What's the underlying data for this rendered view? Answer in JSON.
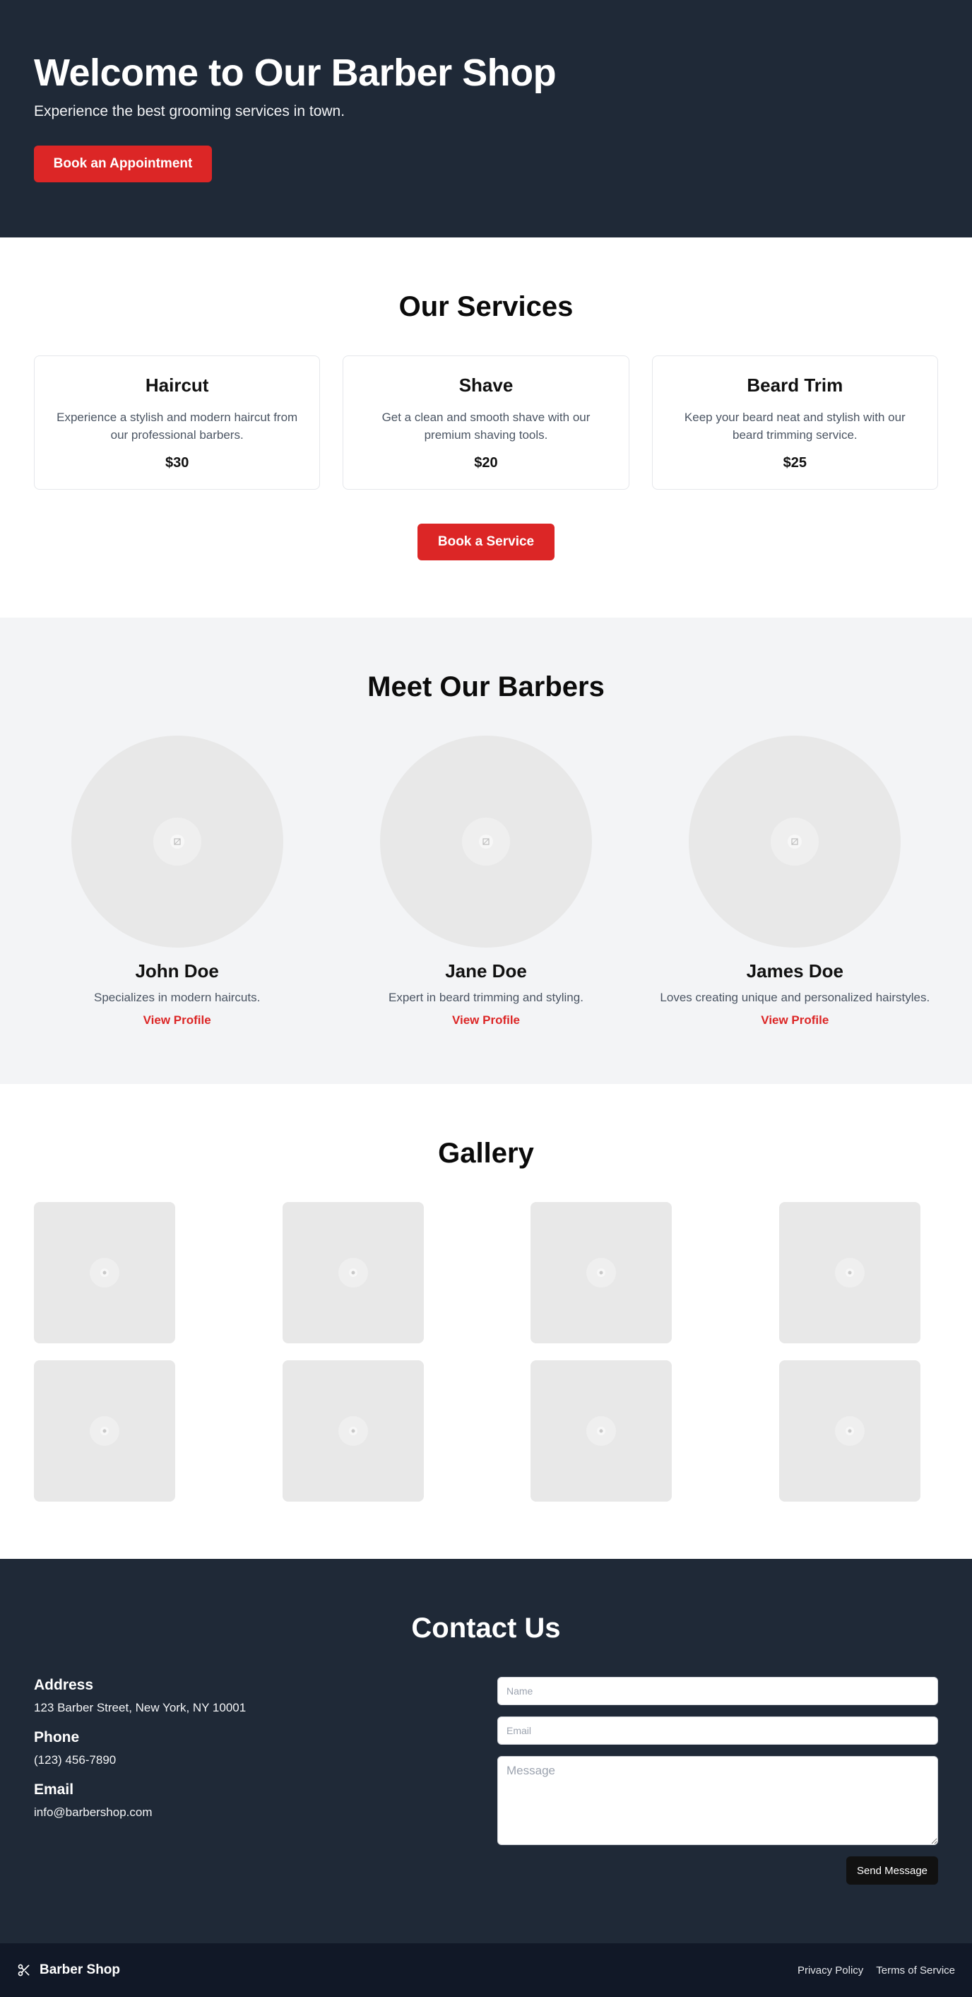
{
  "hero": {
    "title": "Welcome to Our Barber Shop",
    "subtitle": "Experience the best grooming services in town.",
    "cta_label": "Book an Appointment"
  },
  "services": {
    "title": "Our Services",
    "items": [
      {
        "name": "Haircut",
        "description": "Experience a stylish and modern haircut from our professional barbers.",
        "price": "$30"
      },
      {
        "name": "Shave",
        "description": "Get a clean and smooth shave with our premium shaving tools.",
        "price": "$20"
      },
      {
        "name": "Beard Trim",
        "description": "Keep your beard neat and stylish with our beard trimming service.",
        "price": "$25"
      }
    ],
    "cta_label": "Book a Service"
  },
  "barbers": {
    "title": "Meet Our Barbers",
    "items": [
      {
        "name": "John Doe",
        "bio": "Specializes in modern haircuts.",
        "link_label": "View Profile"
      },
      {
        "name": "Jane Doe",
        "bio": "Expert in beard trimming and styling.",
        "link_label": "View Profile"
      },
      {
        "name": "James Doe",
        "bio": "Loves creating unique and personalized hairstyles.",
        "link_label": "View Profile"
      }
    ]
  },
  "gallery": {
    "title": "Gallery",
    "image_count": 8
  },
  "contact": {
    "title": "Contact Us",
    "address_label": "Address",
    "address": "123 Barber Street, New York, NY 10001",
    "phone_label": "Phone",
    "phone": "(123) 456-7890",
    "email_label": "Email",
    "email": "info@barbershop.com",
    "form": {
      "name_placeholder": "Name",
      "email_placeholder": "Email",
      "message_placeholder": "Message",
      "submit_label": "Send Message"
    }
  },
  "footer": {
    "brand": "Barber Shop",
    "brand_icon": "scissors-icon",
    "links": [
      "Privacy Policy",
      "Terms of Service"
    ]
  },
  "colors": {
    "dark": "#1f2937",
    "footer": "#111827",
    "accent": "#dc2626",
    "muted_bg": "#f3f4f6",
    "placeholder": "#e8e8e8"
  }
}
